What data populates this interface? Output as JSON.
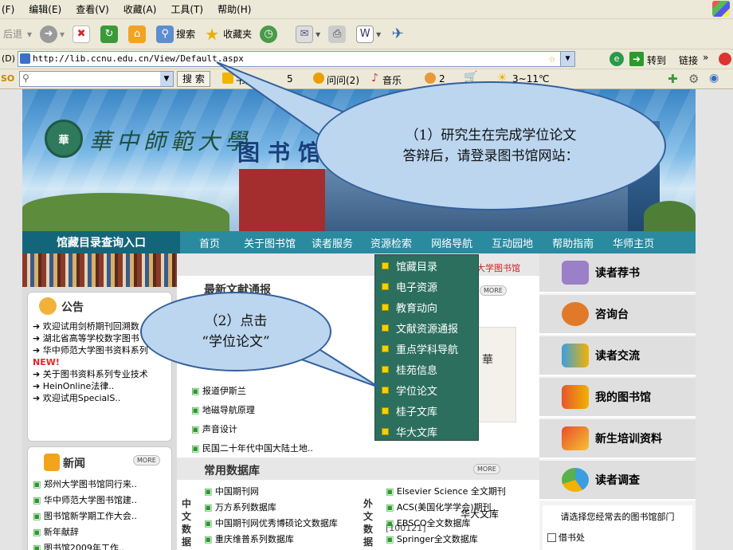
{
  "browser": {
    "menu": [
      "(F)",
      "编辑(E)",
      "查看(V)",
      "收藏(A)",
      "工具(T)",
      "帮助(H)"
    ],
    "toolbar": {
      "back": "后退",
      "search": "搜索",
      "favorites": "收藏夹"
    },
    "address_label": "(D)",
    "url": "http://lib.ccnu.edu.cn/View/Default.aspx",
    "go": "转到",
    "links": "链接",
    "searchbar": {
      "search_btn": "搜 索",
      "bookmark": "书签",
      "num5": "5",
      "ask": "问问(2)",
      "music": "音乐",
      "num2": "2",
      "weather": "3~11℃",
      "so": "SO"
    }
  },
  "site": {
    "logo_text": "華中師範大學",
    "library_text": "图书馆",
    "catalog_entry": "馆藏目录查询入口",
    "nav": [
      "首页",
      "关于图书馆",
      "读者服务",
      "资源检索",
      "网络导航",
      "互动园地",
      "帮助指南",
      "华师主页"
    ],
    "dropdown": [
      "馆藏目录",
      "电子资源",
      "教育动向",
      "文献资源通报",
      "重点学科导航",
      "桂苑信息",
      "学位论文",
      "桂子文库",
      "华大文库"
    ],
    "notice": {
      "title": "公告",
      "items": [
        "欢迎试用剑桥期刊回溯数",
        "湖北省高等学校数字图书",
        "华中师范大学图书资料系列",
        "NEW!",
        "关于图书资料系列专业技术",
        "HeinOnline法律..",
        "欢迎试用SpecialS.."
      ]
    },
    "news": {
      "title": "新闻",
      "more": "MORE",
      "items": [
        "郑州大学图书馆同行来..",
        "华中师范大学图书馆建..",
        "图书馆新学期工作大会..",
        "新年献辞",
        "图书馆2009年工作.."
      ]
    },
    "latest": {
      "title": "最新文献通报",
      "more": "MORE",
      "items": [
        "报道伊斯兰",
        "地磁导航原理",
        "声音设计",
        "民国二十年代中国大陆土地.."
      ],
      "codes": [
        "[100121]"
      ],
      "book_caption": "华大文库",
      "red_text": "华中师范大学图书馆"
    },
    "db": {
      "title": "常用数据库",
      "more": "MORE",
      "cn_label": "中文数据",
      "fg_label": "外文数据",
      "cn": [
        "中国期刊网",
        "万方系列数据库",
        "中国期刊网优秀博硕论文数据库",
        "重庆维普系列数据库"
      ],
      "fg": [
        "Elsevier Science 全文期刊",
        "ACS(美国化学学会)期刊",
        "EBSCO全文数据库",
        "Springer全文数据库"
      ]
    },
    "right": [
      "读者荐书",
      "咨询台",
      "读者交流",
      "我的图书馆",
      "新生培训资料",
      "读者调查"
    ],
    "survey_text": "请选择您经常去的图书馆部门",
    "survey_option": "借书处"
  },
  "callouts": {
    "c1_line1": "（1）研究生在完成学位论文",
    "c1_line2": "答辩后，请登录图书馆网站：",
    "c2_line1": "（2）点击",
    "c2_line2": "“学位论文”"
  }
}
